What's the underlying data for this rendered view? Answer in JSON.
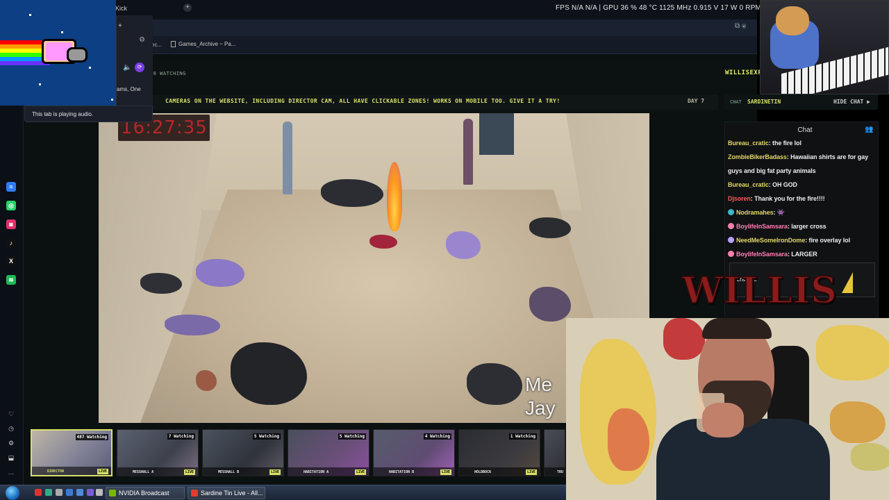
{
  "browser": {
    "gpu_stats": "FPS N/A N/A | GPU 36 % 48 °C 1125 MHz 0.915 V 17 W 0 RPM",
    "tab_partial_label": "Kick",
    "bookmarks": [
      {
        "label": "ec..."
      },
      {
        "label": "Games_Archive ~ Pa..."
      }
    ],
    "addr_icons": "⧉  ⦿"
  },
  "tab_hover": {
    "tooltip": "This tab is playing audio.",
    "partial_text": "ams, One",
    "plus": "+",
    "gear": "⚙",
    "speaker": "🔈",
    "cast": "⟳"
  },
  "site": {
    "watching": "16 WATCHING",
    "logo": "WILLISEXP",
    "marquee": "CAMERAS ON THE WEBSITE, INCLUDING DIRECTOR CAM, ALL HAVE CLICKABLE ZONES! WORKS ON MOBILE TOO. GIVE IT A TRY!",
    "day": "DAY 7",
    "overlay_clock": "16:27:35",
    "overlay_text_lines": [
      "Me",
      "Jay"
    ]
  },
  "chat": {
    "label": "CHAT",
    "username": "SARDINETIN",
    "hide_label": "HIDE CHAT ▶",
    "title": "Chat",
    "input_partial": "scratype",
    "messages": [
      {
        "user": "Bureau_cratic",
        "text": "the fire lol",
        "color": "#e2d86a",
        "badge": ""
      },
      {
        "user": "ZombieBikerBadass",
        "text": "Hawaiian shirts are for gay guys and big fat party animals",
        "color": "#e2d86a",
        "badge": ""
      },
      {
        "user": "Bureau_cratic",
        "text": "OH GOD",
        "color": "#e2d86a",
        "badge": ""
      },
      {
        "user": "Djsoren",
        "text": "Thank you for the fire!!!!",
        "color": "#ff5b5b",
        "badge": ""
      },
      {
        "user": "Nodramahes",
        "text": "👾",
        "color": "#e2d86a",
        "badge": "#3fb6c9"
      },
      {
        "user": "BoylifeInSamsara",
        "text": "larger cross",
        "color": "#ff7fb0",
        "badge": "#ff7fb0"
      },
      {
        "user": "NeedMeSomeIronDome",
        "text": "fire overlay lol",
        "color": "#e2d86a",
        "badge": "#b9a0ff"
      },
      {
        "user": "BoylifeInSamsara",
        "text": "LARGER",
        "color": "#ff7fb0",
        "badge": "#ff7fb0"
      }
    ]
  },
  "willis_logo": "WILLIS",
  "thumbnails": [
    {
      "name": "DIRECTOR",
      "watching": "487 Watching",
      "live": "LIVE",
      "active": true
    },
    {
      "name": "MESSHALL A",
      "watching": "7 Watching",
      "live": "LIVE",
      "active": false
    },
    {
      "name": "MESSHALL B",
      "watching": "5 Watching",
      "live": "LIVE",
      "active": false
    },
    {
      "name": "HABITATION A",
      "watching": "5 Watching",
      "live": "LIVE",
      "active": false
    },
    {
      "name": "HABITATION B",
      "watching": "4 Watching",
      "live": "LIVE",
      "active": false
    },
    {
      "name": "HOLDBOCK",
      "watching": "1 Watching",
      "live": "LIVE",
      "active": false
    },
    {
      "name": "TRU",
      "watching": "",
      "live": "",
      "active": false
    }
  ],
  "sidebar_icons": [
    {
      "name": "messenger-icon",
      "glyph": "≈",
      "color": "#2d7cf6"
    },
    {
      "name": "whatsapp-icon",
      "glyph": "◎",
      "color": "#25d366"
    },
    {
      "name": "instagram-icon",
      "glyph": "◙",
      "color": "#e1306c"
    },
    {
      "name": "tiktok-icon",
      "glyph": "♪",
      "color": "#111111"
    },
    {
      "name": "x-icon",
      "glyph": "X",
      "color": "#111111"
    },
    {
      "name": "spotify-icon",
      "glyph": "≋",
      "color": "#1db954"
    }
  ],
  "sidebar_bottom_icons": [
    "heart-icon",
    "history-icon",
    "settings-icon",
    "extensions-icon",
    "more-icon"
  ],
  "sidebar_bottom_glyphs": [
    "♡",
    "◷",
    "⚙",
    "⬓",
    "…"
  ],
  "taskbar": {
    "tasks": [
      {
        "label": "NVIDIA Broadcast",
        "icon_color": "#76b900"
      },
      {
        "label": "Sardine Tin Live - All...",
        "icon_color": "#e33b2e"
      }
    ]
  }
}
